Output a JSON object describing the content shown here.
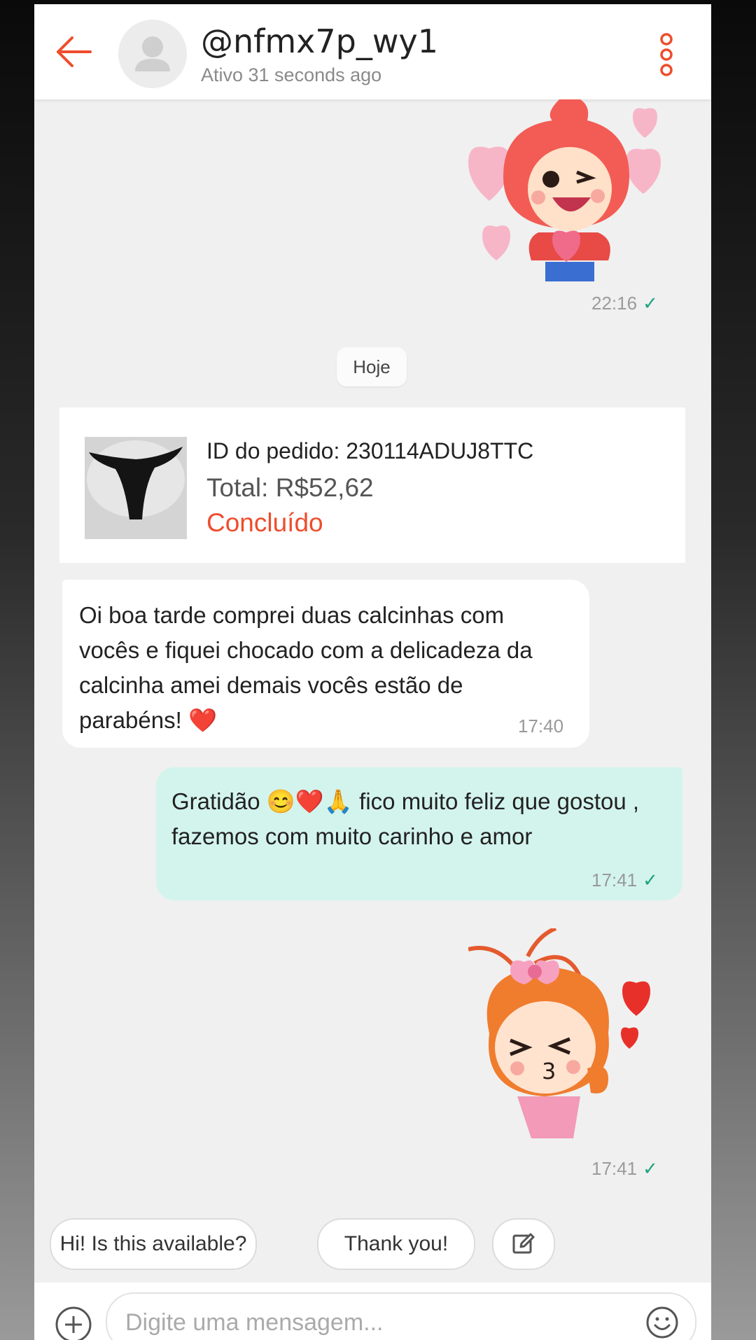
{
  "header": {
    "username": "@nfmx7p_wy1",
    "status": "Ativo 31 seconds ago"
  },
  "messages": {
    "sticker1_time": "22:16",
    "date_separator": "Hoje",
    "order": {
      "id_text": "ID do pedido: 230114ADUJ8TTC",
      "total_text": "Total: R$52,62",
      "status_text": "Concluído"
    },
    "incoming_text": "Oi boa tarde comprei duas calcinhas com vocês e fiquei chocado com a delicadeza da calcinha amei demais vocês estão de parabéns! ❤️",
    "incoming_time": "17:40",
    "outgoing_text": "Gratidão 😊❤️🙏 fico muito feliz que gostou , fazemos com muito carinho e amor",
    "outgoing_time": "17:41",
    "sticker2_time": "17:41",
    "tick": "✓"
  },
  "quick_replies": {
    "chip1": "Hi! Is this available?",
    "chip2": "Thank you!"
  },
  "composer": {
    "placeholder": "Digite uma mensagem..."
  },
  "colors": {
    "accent": "#ee4d2d",
    "outgoing_bubble": "#d3f4ec",
    "tick": "#1ca37f"
  },
  "icons": [
    "back-arrow-icon",
    "avatar-placeholder-icon",
    "more-vertical-icon",
    "edit-icon",
    "plus-icon",
    "emoji-icon",
    "check-icon"
  ]
}
